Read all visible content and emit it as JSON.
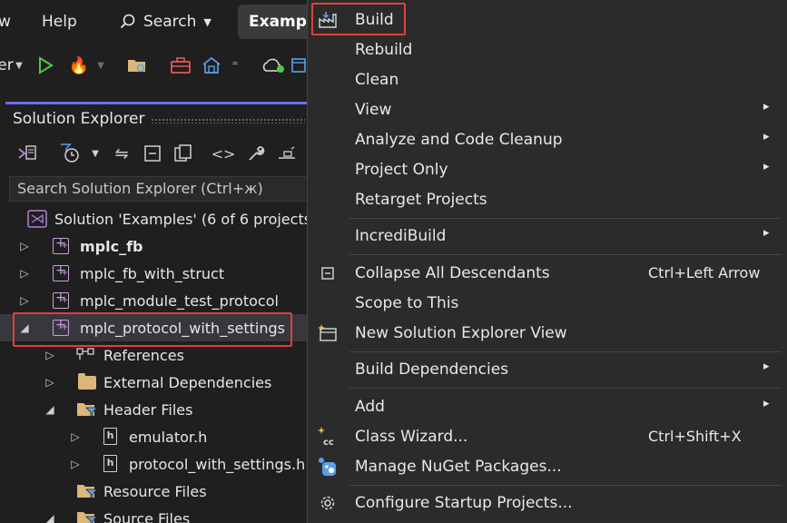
{
  "menubar": {
    "items": [
      "w",
      "Help"
    ],
    "search_label": "Search",
    "title_tab": "Examples"
  },
  "toolbar": {
    "config_fragment": "er"
  },
  "solution_explorer": {
    "title": "Solution Explorer",
    "search_placeholder": "Search Solution Explorer (Ctrl+ж)",
    "tree": [
      {
        "label": "Solution 'Examples' (6 of 6 projects",
        "kind": "solution"
      },
      {
        "label": "mplc_fb",
        "kind": "project",
        "bold": true
      },
      {
        "label": "mplc_fb_with_struct",
        "kind": "project"
      },
      {
        "label": "mplc_module_test_protocol",
        "kind": "project"
      },
      {
        "label": "mplc_protocol_with_settings",
        "kind": "project",
        "selected": true
      },
      {
        "label": "References",
        "kind": "references"
      },
      {
        "label": "External Dependencies",
        "kind": "folder"
      },
      {
        "label": "Header Files",
        "kind": "filter-folder"
      },
      {
        "label": "emulator.h",
        "kind": "file"
      },
      {
        "label": "protocol_with_settings.h",
        "kind": "file"
      },
      {
        "label": "Resource Files",
        "kind": "filter-folder"
      },
      {
        "label": "Source Files",
        "kind": "filter-folder"
      }
    ]
  },
  "context_menu": {
    "items": [
      {
        "label": "Build",
        "icon": "build-icon"
      },
      {
        "label": "Rebuild"
      },
      {
        "label": "Clean"
      },
      {
        "label": "View",
        "submenu": true
      },
      {
        "label": "Analyze and Code Cleanup",
        "submenu": true
      },
      {
        "label": "Project Only",
        "submenu": true
      },
      {
        "label": "Retarget Projects"
      },
      {
        "label": "IncrediBuild",
        "submenu": true
      },
      {
        "label": "Collapse All Descendants",
        "shortcut": "Ctrl+Left Arrow",
        "icon": "collapse-icon"
      },
      {
        "label": "Scope to This"
      },
      {
        "label": "New Solution Explorer View",
        "icon": "new-view-icon"
      },
      {
        "label": "Build Dependencies",
        "submenu": true
      },
      {
        "label": "Add",
        "submenu": true
      },
      {
        "label": "Class Wizard...",
        "shortcut": "Ctrl+Shift+X",
        "icon": "class-wizard-icon"
      },
      {
        "label": "Manage NuGet Packages...",
        "icon": "nuget-icon"
      },
      {
        "label": "Configure Startup Projects...",
        "icon": "gear-icon"
      }
    ],
    "arrow_glyph": "▸"
  }
}
